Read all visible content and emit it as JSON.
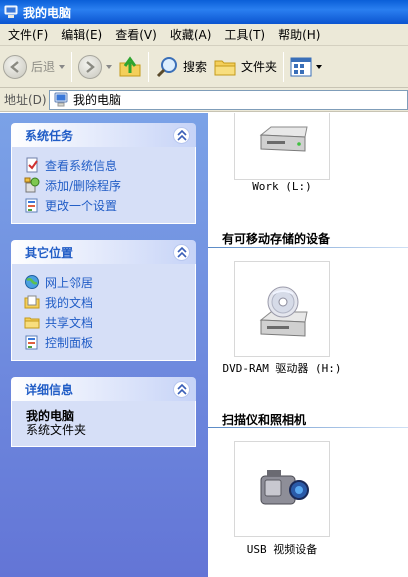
{
  "window": {
    "title": "我的电脑"
  },
  "menubar": [
    "文件(F)",
    "编辑(E)",
    "查看(V)",
    "收藏(A)",
    "工具(T)",
    "帮助(H)"
  ],
  "toolbar": {
    "back": "后退",
    "search": "搜索",
    "folders": "文件夹"
  },
  "address": {
    "label": "地址(D)",
    "value": "我的电脑"
  },
  "sidebar": {
    "system_tasks": {
      "title": "系统任务",
      "items": [
        {
          "label": "查看系统信息"
        },
        {
          "label": "添加/删除程序"
        },
        {
          "label": "更改一个设置"
        }
      ]
    },
    "other_places": {
      "title": "其它位置",
      "items": [
        {
          "label": "网上邻居"
        },
        {
          "label": "我的文档"
        },
        {
          "label": "共享文档"
        },
        {
          "label": "控制面板"
        }
      ]
    },
    "details": {
      "title": "详细信息",
      "name": "我的电脑",
      "desc": "系统文件夹"
    }
  },
  "content": {
    "drive_work": {
      "label": "Work (L:)"
    },
    "group_removable": {
      "title": "有可移动存储的设备"
    },
    "drive_dvd": {
      "label": "DVD-RAM 驱动器 (H:)"
    },
    "group_scanners": {
      "title": "扫描仪和照相机"
    },
    "usb_video": {
      "label": "USB 视频设备"
    }
  },
  "colors": {
    "title_bar": "#0a5fd8",
    "task_link": "#215dc6",
    "left_pane": "#6f8ee0"
  }
}
